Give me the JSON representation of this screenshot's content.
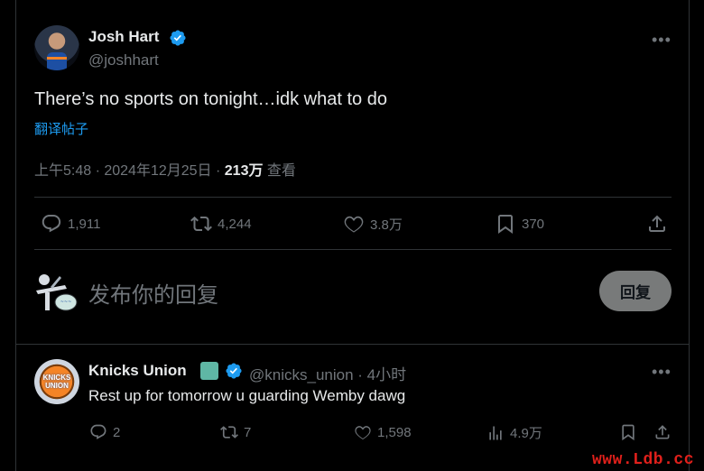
{
  "tweet": {
    "author_name": "Josh Hart",
    "author_handle": "@joshhart",
    "text": "There’s no sports on tonight…idk what to do",
    "translate_label": "翻译帖子",
    "time": "上午5:48 · 2024年12月25日 · ",
    "views": "213万",
    "views_label": " 查看",
    "replies": "1,911",
    "retweets": "4,244",
    "likes": "3.8万",
    "bookmarks": "370"
  },
  "compose": {
    "placeholder": "发布你的回复",
    "reply_button": "回复"
  },
  "reply": {
    "author_name": "Knicks Union",
    "author_handle": "@knicks_union · 4小时",
    "avatar_text_1": "KNICKS",
    "avatar_text_2": "UNION",
    "text": "Rest up for tomorrow u guarding Wemby dawg",
    "replies": "2",
    "retweets": "7",
    "likes": "1,598",
    "views": "4.9万"
  },
  "watermark": "www.Ldb.cc",
  "colors": {
    "background": "#000000",
    "accent": "#1d9bf0",
    "muted": "#71767b",
    "text": "#e7e9ea",
    "border": "#2f3336",
    "watermark": "#e0201b"
  }
}
